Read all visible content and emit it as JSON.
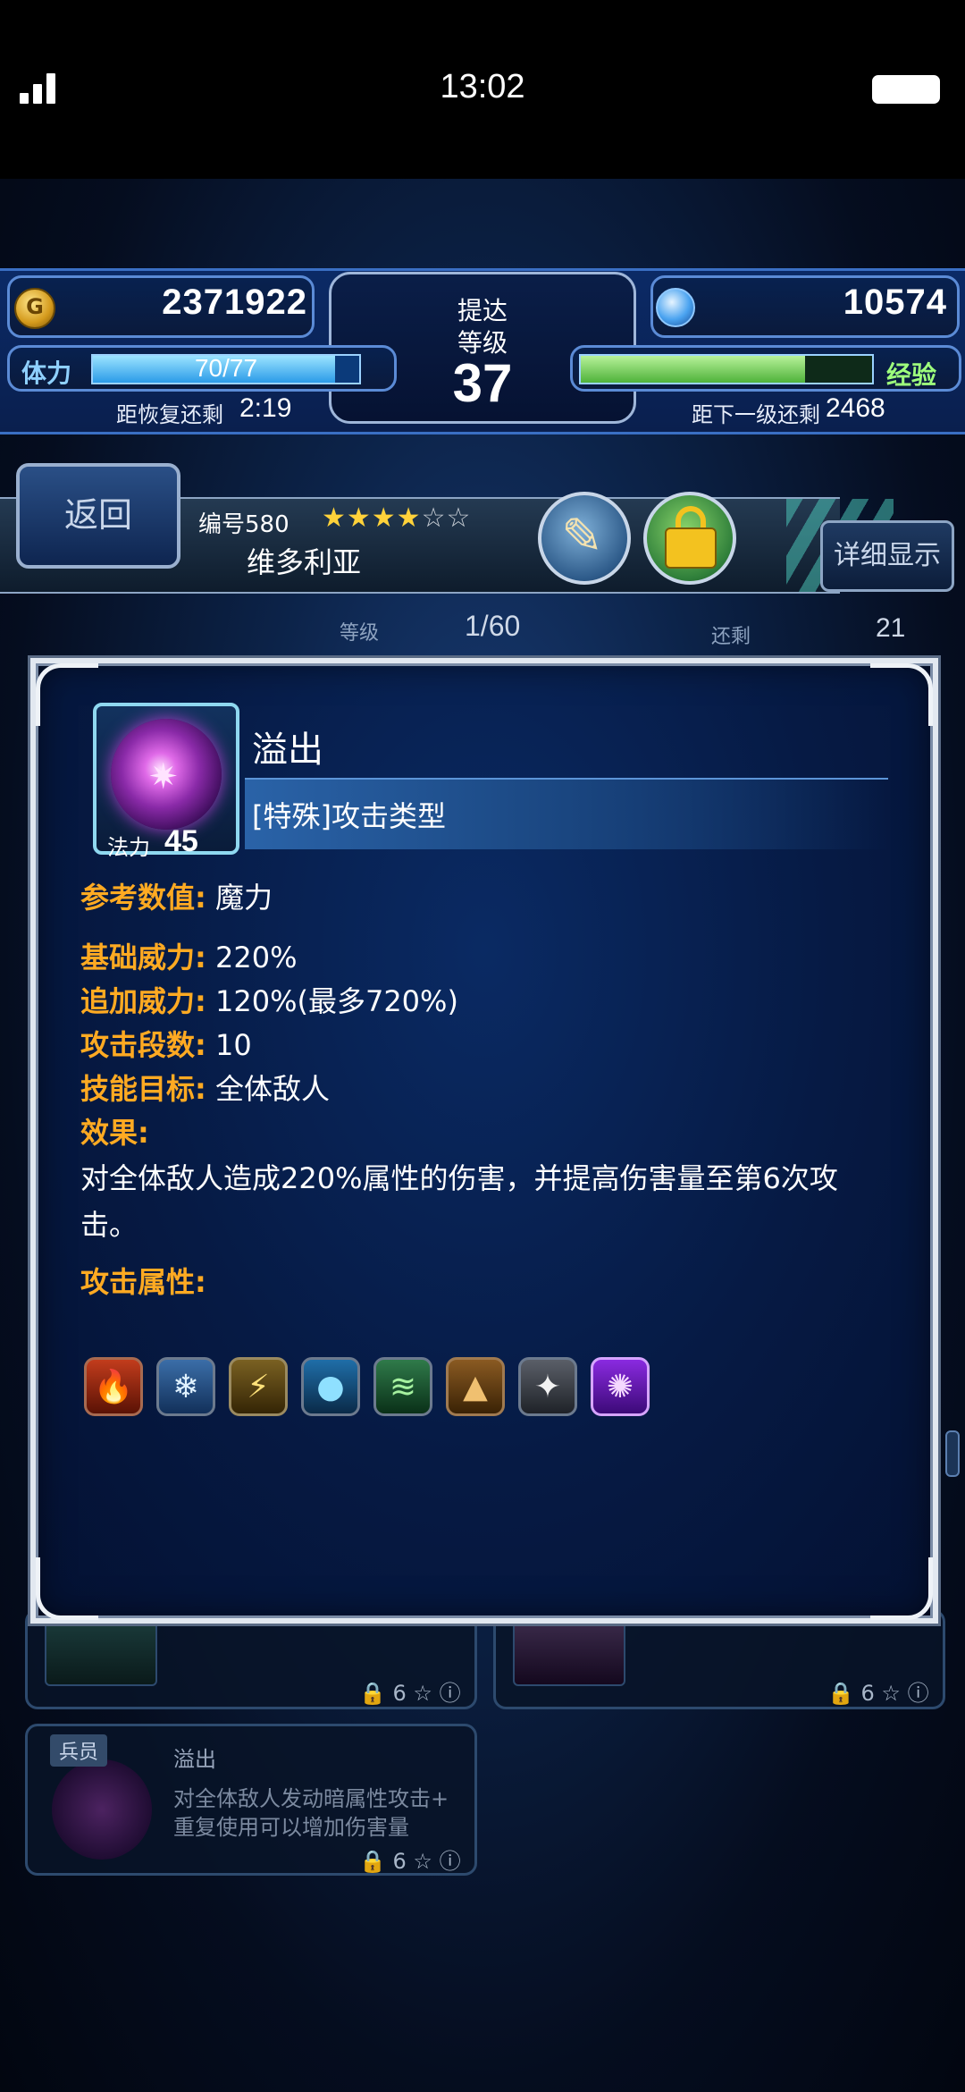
{
  "status_bar": {
    "time": "13:02"
  },
  "hud": {
    "gil": "2371922",
    "lapis": "10574",
    "rank_name": "提达",
    "rank_label": "等级",
    "rank_value": "37",
    "stamina_label": "体力",
    "stamina_text": "70/77",
    "stamina_fraction": 0.909,
    "stamina_recover_label": "距恢复还剩",
    "stamina_recover_time": "2:19",
    "exp_label": "经验",
    "exp_fraction": 0.77,
    "exp_remaining_label": "距下一级还剩",
    "exp_remaining_value": "2468"
  },
  "unit": {
    "back_label": "返回",
    "number": "编号580",
    "stars_filled": "★★★★",
    "stars_empty": "☆☆",
    "name": "维多利亚",
    "detail_label": "详细显示"
  },
  "background": {
    "level_label": "等级",
    "level_value": "1/60",
    "remaining_label": "还剩",
    "remaining_value": "21",
    "card_lock_stat": "6",
    "card3_tag": "兵员",
    "card3_title": "溢出",
    "card3_desc_line1": "对全体敌人发动暗属性攻击+",
    "card3_desc_line2": "重复使用可以增加伤害量"
  },
  "skill": {
    "name": "溢出",
    "type": "[特殊]攻击类型",
    "mp_label": "法力",
    "mp_value": "45",
    "ref_label": "参考数值",
    "ref_value": "魔力",
    "base_power_label": "基础威力",
    "base_power_value": "220%",
    "added_power_label": "追加威力",
    "added_power_value": "120%(最多720%)",
    "hits_label": "攻击段数",
    "hits_value": "10",
    "target_label": "技能目标",
    "target_value": "全体敌人",
    "effect_label": "效果",
    "effect_text": "对全体敌人造成220%属性的伤害，并提高伤害量至第6次攻击。",
    "attr_label": "攻击属性",
    "colon": ":",
    "elements": [
      {
        "name": "fire",
        "active": false
      },
      {
        "name": "ice",
        "active": false
      },
      {
        "name": "lightning",
        "active": false
      },
      {
        "name": "water",
        "active": false
      },
      {
        "name": "wind",
        "active": false
      },
      {
        "name": "earth",
        "active": false
      },
      {
        "name": "holy",
        "active": false
      },
      {
        "name": "dark",
        "active": true
      }
    ]
  },
  "colors": {
    "label_orange": "#ffaa22",
    "stamina_blue": "#2b9be8",
    "exp_green": "#4fb23a",
    "dark_element_purple": "#8a2ae0"
  }
}
